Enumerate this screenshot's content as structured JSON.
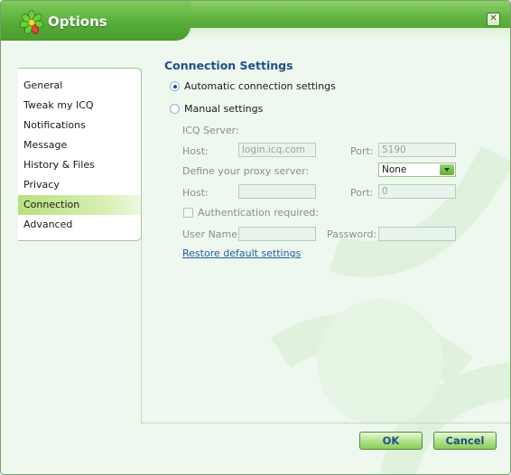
{
  "window": {
    "title": "Options",
    "close_glyph": "✕"
  },
  "sidebar": {
    "items": [
      {
        "label": "General"
      },
      {
        "label": "Tweak my ICQ"
      },
      {
        "label": "Notifications"
      },
      {
        "label": "Message"
      },
      {
        "label": "History & Files"
      },
      {
        "label": "Privacy"
      },
      {
        "label": "Connection",
        "active": true
      },
      {
        "label": "Advanced"
      }
    ]
  },
  "connection": {
    "title": "Connection Settings",
    "auto_label": "Automatic connection settings",
    "manual_label": "Manual settings",
    "selected": "Automatic connection settings",
    "icq_server_label": "ICQ Server:",
    "host_label": "Host:",
    "host_value": "login.icq.com",
    "port_label": "Port:",
    "port_value": "5190",
    "proxy_label": "Define your proxy server:",
    "proxy_value": "None",
    "proxy_host_label": "Host:",
    "proxy_host_value": "",
    "proxy_port_label": "Port:",
    "proxy_port_value": "0",
    "auth_label": "Authentication required:",
    "username_label": "User Name:",
    "username_value": "",
    "password_label": "Password:",
    "password_value": "",
    "restore_link": "Restore default settings"
  },
  "footer": {
    "ok_label": "OK",
    "cancel_label": "Cancel"
  },
  "colors": {
    "accent": "#5fb23f",
    "title_text": "#1f4e8c"
  }
}
